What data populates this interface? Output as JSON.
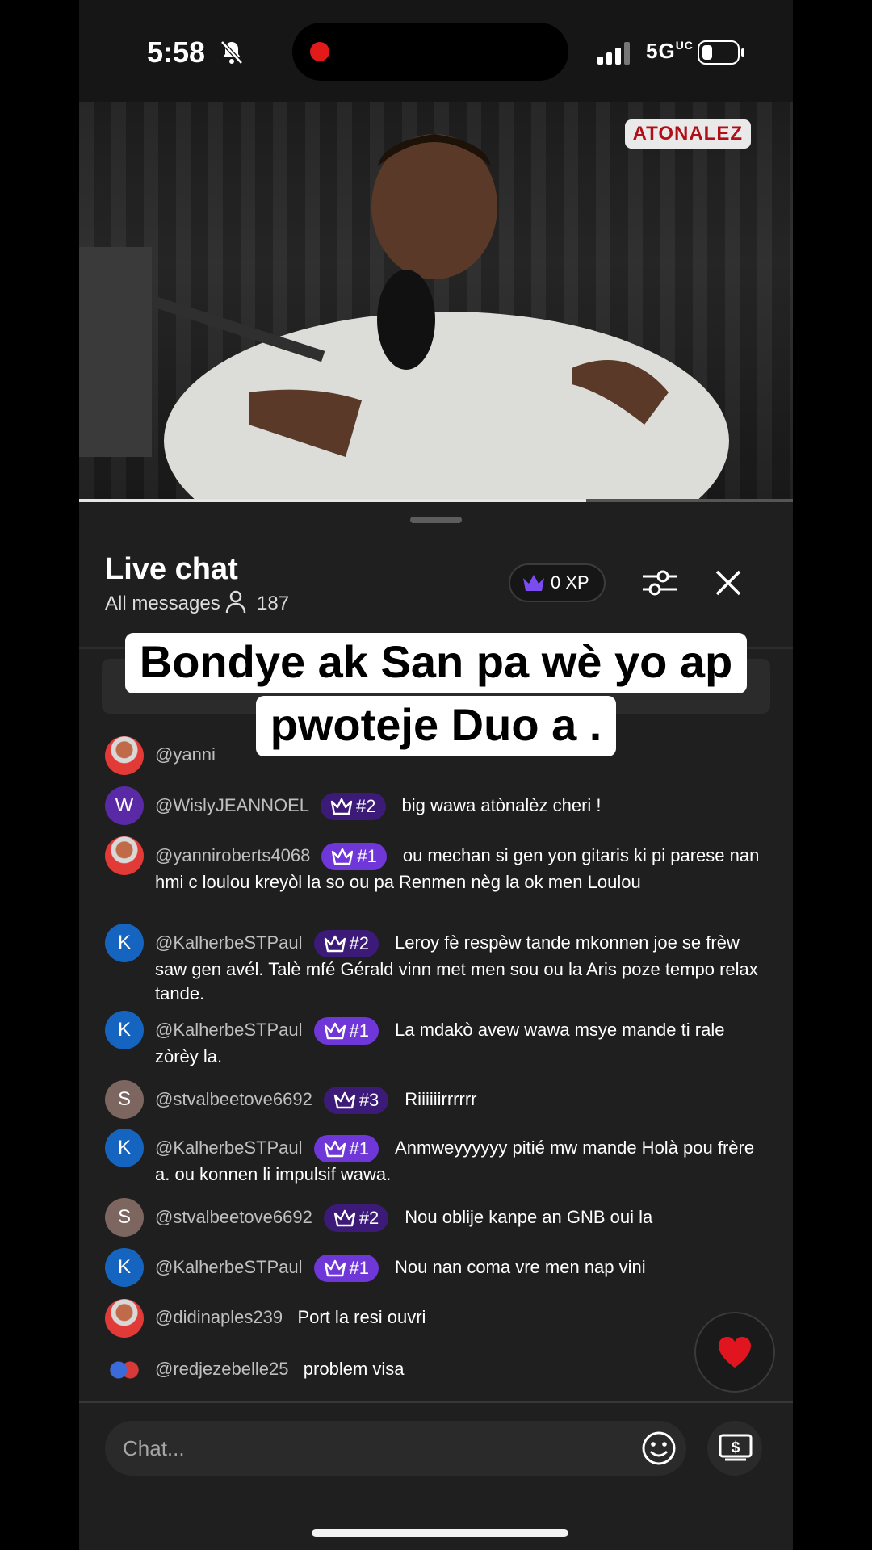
{
  "status": {
    "time": "5:58",
    "network": "5G",
    "network_sub": "UC"
  },
  "video": {
    "logo": "ATONALEZ",
    "progress": 0.71
  },
  "chat": {
    "title": "Live chat",
    "filter": "All messages",
    "viewers": "187",
    "xp": "0 XP",
    "input_placeholder": "Chat..."
  },
  "caption": {
    "line1": "Bondye ak San pa wè yo ap",
    "line2": "pwoteje Duo a ."
  },
  "messages": [
    {
      "user": "@yanni",
      "avatar": "photo",
      "badge": "",
      "text": ""
    },
    {
      "user": "@WislyJEANNOEL",
      "avatar": "W",
      "badge": "#2",
      "text": "big wawa atònalèz cheri !"
    },
    {
      "user": "@yanniroberts4068",
      "avatar": "photo",
      "badge": "#1",
      "text": "ou mechan si gen yon gitaris ki pi parese nan hmi c loulou kreyòl la so ou pa Renmen nèg la ok men Loulou"
    },
    {
      "user": "@KalherbeSTPaul",
      "avatar": "K",
      "badge": "#2",
      "text": "Leroy fè respèw tande mkonnen joe se frèw saw gen avél. Talè mfé Gérald vinn met men sou ou la Aris poze tempo relax tande."
    },
    {
      "user": "@KalherbeSTPaul",
      "avatar": "K",
      "badge": "#1",
      "text": "La mdakò avew wawa msye mande ti rale zòrèy la."
    },
    {
      "user": "@stvalbeetove6692",
      "avatar": "S",
      "badge": "#3",
      "text": "Riiiiiirrrrrr"
    },
    {
      "user": "@KalherbeSTPaul",
      "avatar": "K",
      "badge": "#1",
      "text": "Anmweyyyyyy pitié mw mande Holà pou frère a. ou konnen li impulsif wawa."
    },
    {
      "user": "@stvalbeetove6692",
      "avatar": "S",
      "badge": "#2",
      "text": "Nou oblije kanpe an GNB oui la"
    },
    {
      "user": "@KalherbeSTPaul",
      "avatar": "K",
      "badge": "#1",
      "text": "Nou nan coma vre men nap vini"
    },
    {
      "user": "@didinaples239",
      "avatar": "photo",
      "badge": "",
      "text": "Port la resi ouvri"
    },
    {
      "user": "@redjezebelle25",
      "avatar": "hearts",
      "badge": "",
      "text": "problem visa"
    }
  ],
  "colors": {
    "badge_purple": "#6f36d8",
    "badge_dark_purple": "#3c1a78",
    "avatar_w": "#5a2aa6",
    "avatar_k": "#1565c0",
    "avatar_s": "#7d6660",
    "heart": "#e0151f"
  },
  "icons": {
    "bell": "bell-slash-icon",
    "viewer": "person-icon",
    "xp": "crown-icon",
    "filter": "sliders-icon",
    "close": "close-icon",
    "emoji": "emoji-icon",
    "money": "money-icon",
    "heart": "heart-icon"
  }
}
